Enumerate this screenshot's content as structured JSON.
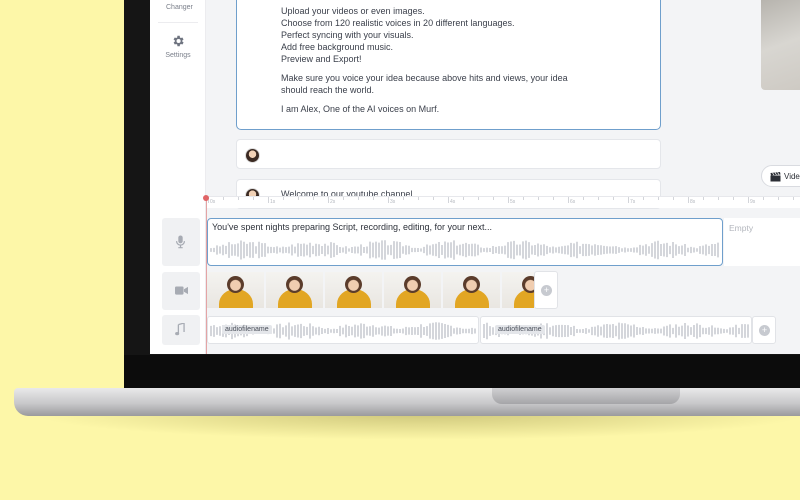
{
  "sidebar": {
    "voice_changer_label": "Voice Changer",
    "settings_label": "Settings"
  },
  "script": {
    "lines": [
      "Upload your videos or even images.",
      "Choose from 120 realistic voices in 20 different languages.",
      "Perfect syncing with your visuals.",
      "Add free background music.",
      "Preview and Export!"
    ],
    "paragraph2_line1": "Make sure you voice your idea because above hits and views, your idea",
    "paragraph2_line2": "should reach the world.",
    "paragraph3": "I am Alex, One of the AI voices on Murf."
  },
  "blocks": {
    "block2_text": "",
    "block3_text": "Welcome to our youtube channel."
  },
  "video_settings": {
    "label": "Video Settings"
  },
  "ruler": {
    "labels": [
      "0s",
      "1s",
      "2s",
      "3s",
      "4s",
      "5s",
      "6s",
      "7s",
      "8s",
      "9s"
    ]
  },
  "timeline": {
    "voice_text": "You've spent nights preparing Script, recording, editing, for your next...",
    "empty_label": "Empty",
    "music_tags": [
      "audiofilename",
      "audiofilename"
    ]
  },
  "colors": {
    "background": "#fdf7a8",
    "accent_border": "#6f9fcc",
    "playhead": "#e06466"
  },
  "icons": [
    "mic-icon",
    "video-icon",
    "music-note-icon",
    "gear-icon",
    "clapperboard-icon",
    "plus-icon"
  ]
}
